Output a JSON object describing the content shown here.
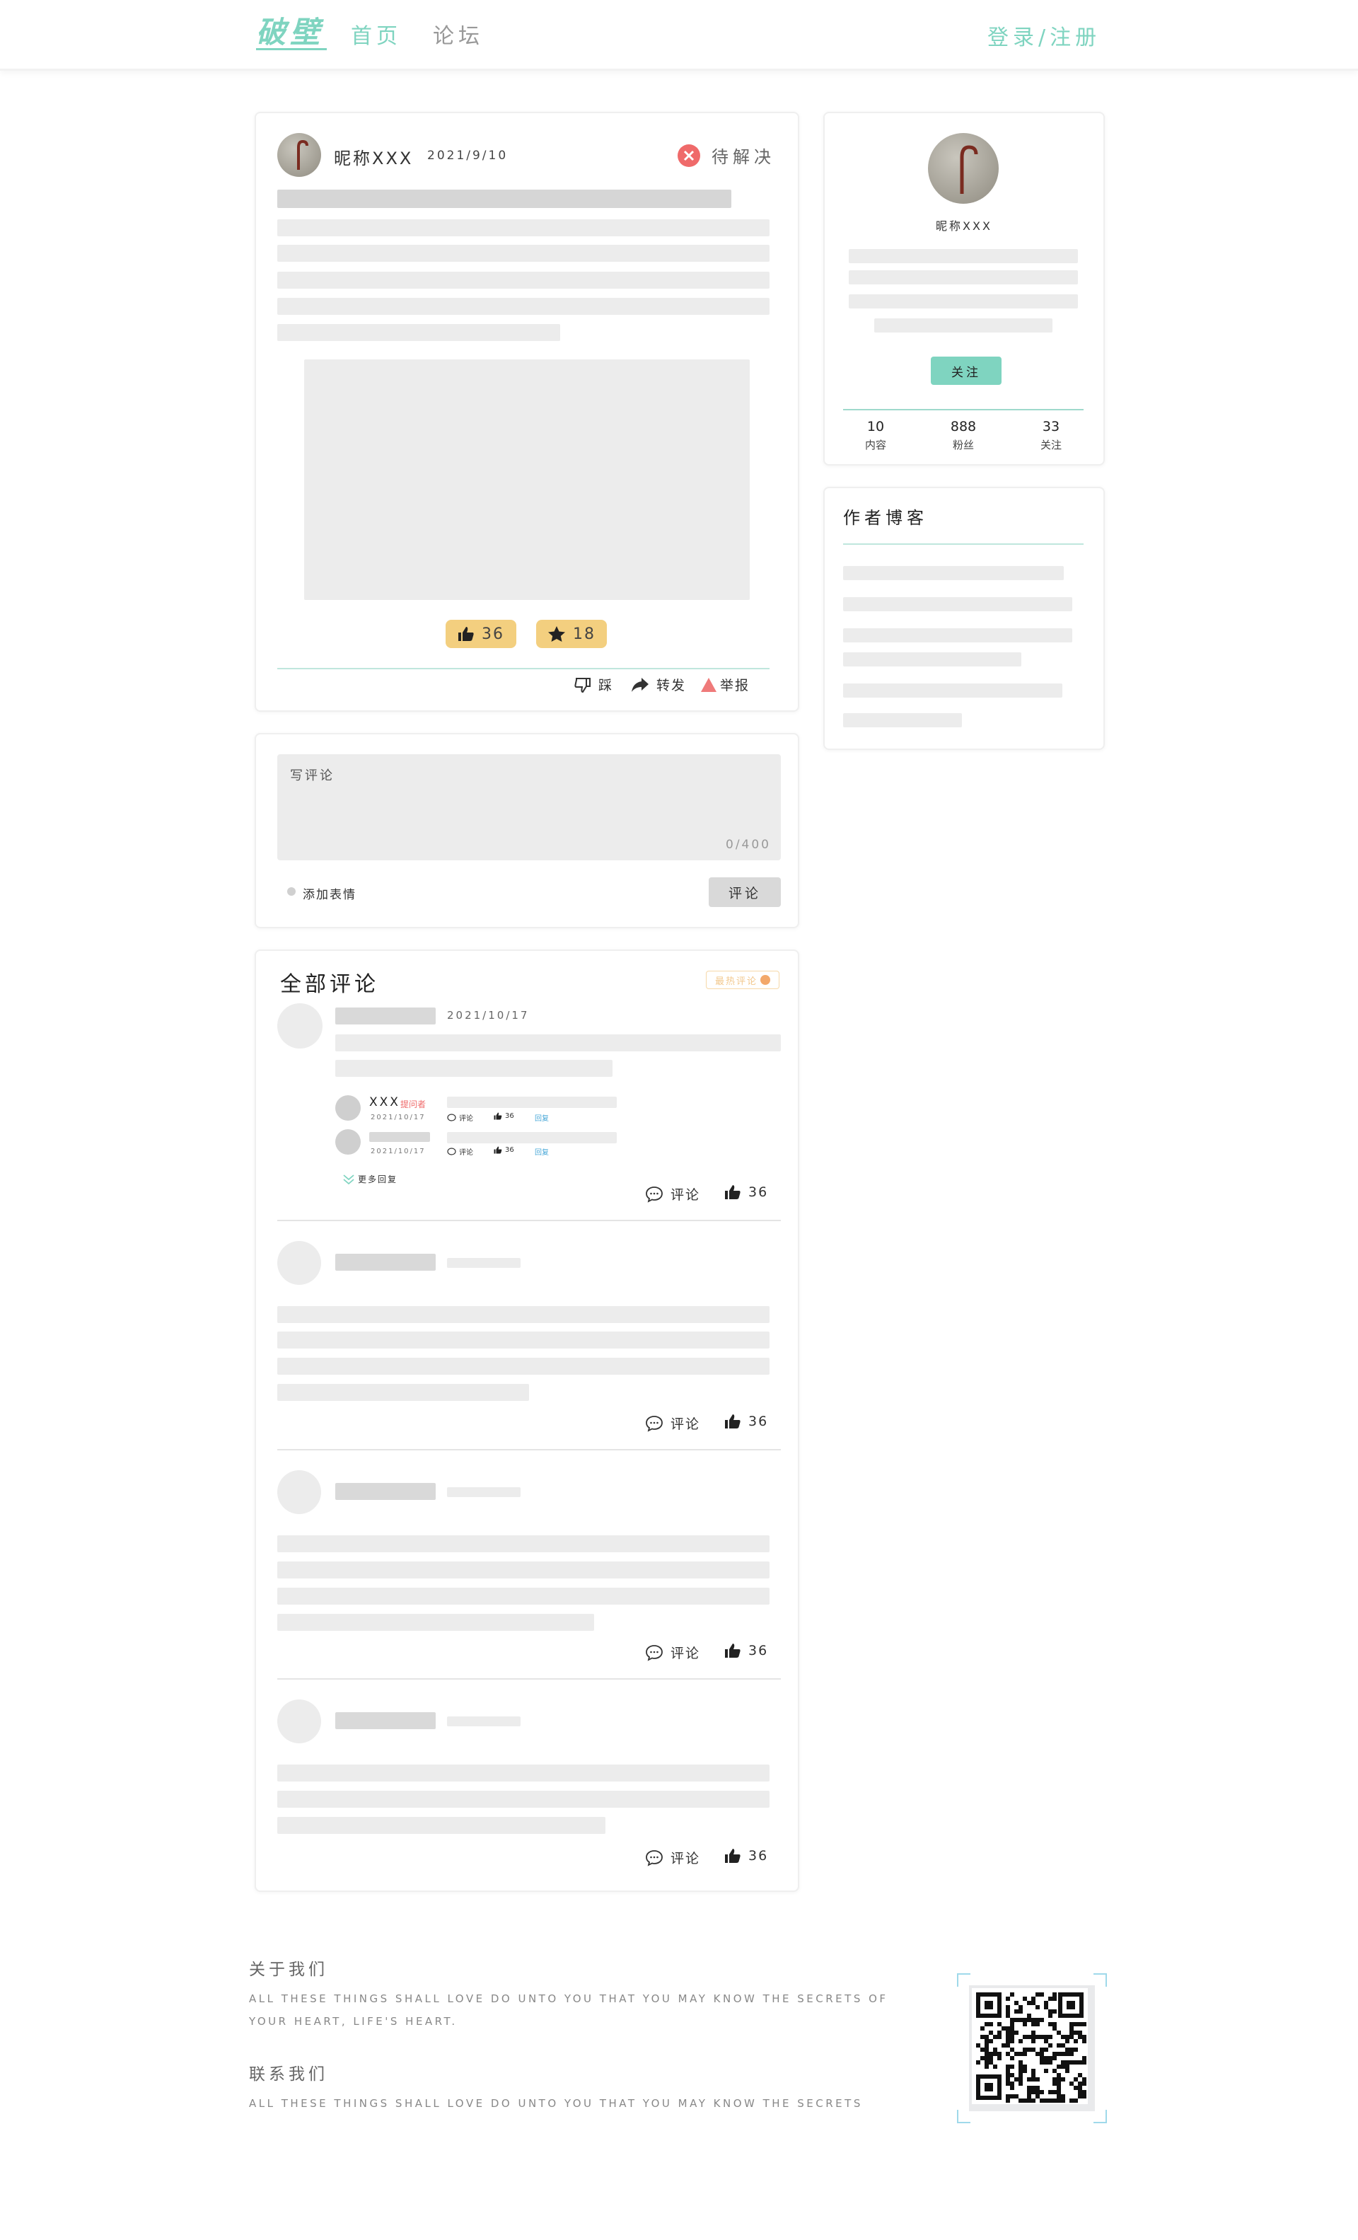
{
  "header": {
    "logo": "破壁",
    "nav": [
      {
        "label": "首页",
        "active": true
      },
      {
        "label": "论坛",
        "active": false
      }
    ],
    "auth": "登录/注册"
  },
  "post": {
    "author": "昵称XXX",
    "date": "2021/9/10",
    "status": "待解决",
    "likes": "36",
    "stars": "18",
    "actions": {
      "dislike": "踩",
      "share": "转发",
      "report": "举报"
    }
  },
  "comment_box": {
    "placeholder": "写评论",
    "counter": "0/400",
    "emoji": "添加表情",
    "submit": "评论"
  },
  "comments": {
    "title": "全部评论",
    "sort_label": "最热评论",
    "first_date": "2021/10/17",
    "replies": [
      {
        "name": "XXX",
        "badge": "提问者",
        "date": "2021/10/17",
        "comment": "评论",
        "likes": "36",
        "reply": "回复"
      },
      {
        "name": "",
        "badge": "",
        "date": "2021/10/17",
        "comment": "评论",
        "likes": "36",
        "reply": "回复"
      }
    ],
    "more_replies": "更多回复",
    "comment_label": "评论",
    "like_count": "36"
  },
  "profile": {
    "name": "昵称XXX",
    "follow": "关注",
    "stats": [
      {
        "value": "10",
        "label": "内容"
      },
      {
        "value": "888",
        "label": "粉丝"
      },
      {
        "value": "33",
        "label": "关注"
      }
    ]
  },
  "blog": {
    "title": "作者博客"
  },
  "footer": {
    "about_title": "关于我们",
    "about_text_1": "ALL THESE THINGS SHALL LOVE DO UNTO YOU THAT YOU MAY KNOW THE SECRETS OF",
    "about_text_2": "YOUR HEART, LIFE'S HEART.",
    "contact_title": "联系我们",
    "contact_text": "ALL THESE THINGS SHALL LOVE DO UNTO YOU THAT YOU MAY KNOW THE SECRETS"
  },
  "colors": {
    "accent": "#7fd4c0",
    "gold": "#f3cf7f",
    "status_red": "#ef6a6a",
    "report_red": "#ef7a7a"
  }
}
